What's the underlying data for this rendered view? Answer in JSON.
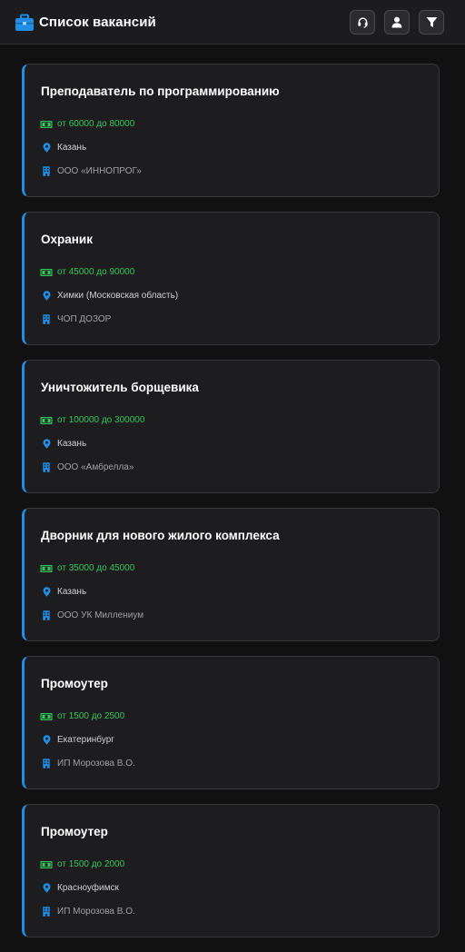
{
  "header": {
    "title": "Список вакансий",
    "icons": [
      "briefcase-icon",
      "headset-icon",
      "user-icon",
      "filter-icon"
    ]
  },
  "colors": {
    "accent": "#1e8ee6",
    "salary": "#34c759",
    "background": "#111111",
    "card": "#1d1d1f"
  },
  "vacancies": [
    {
      "title": "Преподаватель по программированию",
      "salary": "от 60000 до 80000",
      "location": "Казань",
      "company": "ООО «ИННОПРОГ»"
    },
    {
      "title": "Охраник",
      "salary": "от 45000 до 90000",
      "location": "Химки (Московская область)",
      "company": "ЧОП ДОЗОР"
    },
    {
      "title": "Уничтожитель борщевика",
      "salary": "от 100000 до 300000",
      "location": "Казань",
      "company": "ООО «Амбрелла»"
    },
    {
      "title": "Дворник для нового жилого комплекса",
      "salary": "от 35000 до 45000",
      "location": "Казань",
      "company": "ООО УК Миллениум"
    },
    {
      "title": "Промоутер",
      "salary": "от 1500 до 2500",
      "location": "Екатеринбург",
      "company": "ИП Морозова В.О."
    },
    {
      "title": "Промоутер",
      "salary": "от 1500 до 2000",
      "location": "Красноуфимск",
      "company": "ИП Морозова В.О."
    }
  ]
}
